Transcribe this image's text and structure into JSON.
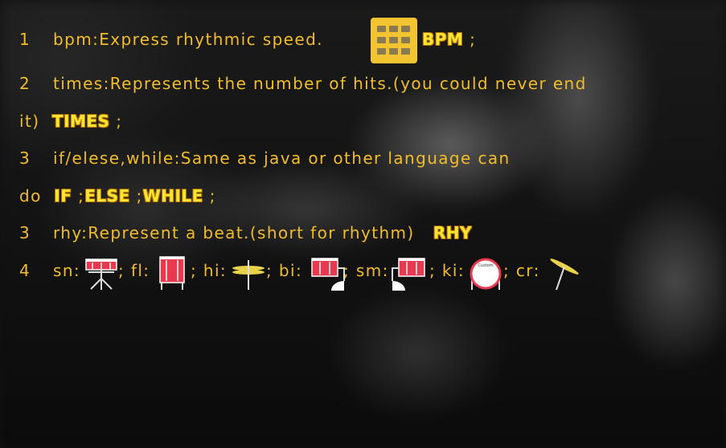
{
  "lines": [
    {
      "num": "1",
      "text": "bpm:Express rhythmic speed.",
      "kw": "BPM",
      "after": " ;"
    },
    {
      "num": "2",
      "text": "times:Represents the number of hits.(you could never end"
    },
    {
      "text": "it)",
      "kw": "TIMES",
      "after": " ;"
    },
    {
      "num": "3",
      "text": "if/elese,while:Same as java or other language can"
    },
    {
      "text": "do",
      "kw1": "IF",
      "sep1": " ;",
      "kw2": "ELSE",
      "sep2": " ;",
      "kw3": "WHILE",
      "after": " ;"
    },
    {
      "num": "3",
      "text": "rhy:Represent a beat.(short for rhythm)",
      "kw": "RHY"
    },
    {
      "num": "4",
      "sn": "sn:",
      "fl": "; fl:",
      "hi": "; hi:",
      "bi": "; bi:",
      "sm": "; sm:",
      "ki": "; ki:",
      "cr": "; cr:"
    }
  ],
  "icons": {
    "bpm_block": "block-grid-icon",
    "sn": "snare-drum-icon",
    "fl": "floor-tom-icon",
    "hi": "hi-hat-icon",
    "bi": "bass-tom-icon",
    "sm": "small-tom-icon",
    "ki": "kick-drum-icon",
    "cr": "crash-cymbal-icon"
  },
  "kick_label": "Custom",
  "colors": {
    "text": "#f2bd2a",
    "keyword": "#ffe533",
    "block": "#f4c430",
    "drum": "#e8394f",
    "cymbal": "#e9d24a"
  }
}
